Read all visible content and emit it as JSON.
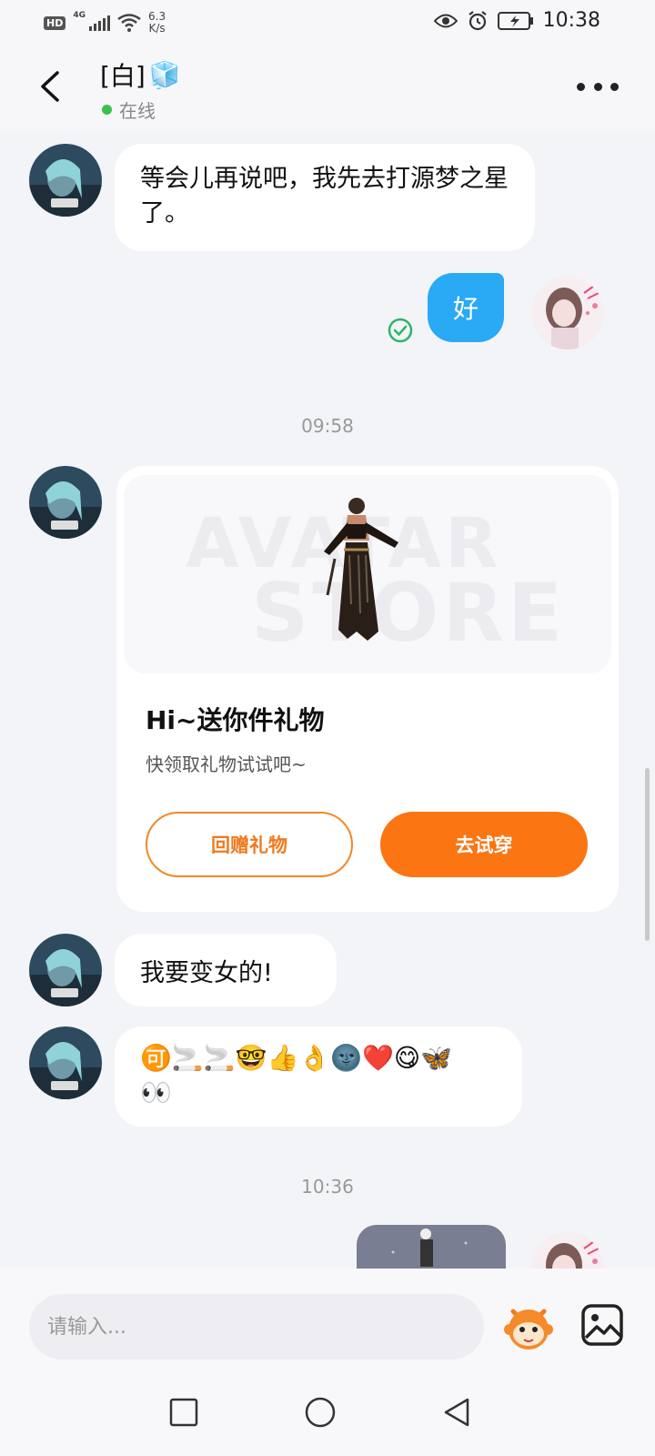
{
  "status_bar": {
    "hd": "HD",
    "network": "4G",
    "speed_value": "6.3",
    "speed_unit": "K/s",
    "time": "10:38"
  },
  "header": {
    "contact_name": "[白]",
    "contact_emoji": "🧊",
    "status": "在线",
    "status_color": "#3ac24c"
  },
  "messages": {
    "m1": {
      "from": "them",
      "text": "等会儿再说吧，我先去打源梦之星了。"
    },
    "m2": {
      "from": "me",
      "text": "好",
      "read_icon": "check-circle-icon"
    },
    "time1": "09:58",
    "gift": {
      "title": "Hi~送你件礼物",
      "subtitle": "快领取礼物试试吧~",
      "watermark_line1": "AVATAR",
      "watermark_line2": "STORE",
      "btn_return": "回赠礼物",
      "btn_try": "去试穿"
    },
    "m3": {
      "from": "them",
      "text": "我要变女的!"
    },
    "m4": {
      "from": "them",
      "text_line1": "🉑🚬🚬🤓👍👌🌚❤️😋🦋",
      "text_line2": "👀"
    },
    "time2": "10:36"
  },
  "input": {
    "placeholder": "请输入..."
  },
  "colors": {
    "accent_blue": "#2aa9f5",
    "accent_orange": "#fb7512",
    "read_green": "#2fb36a"
  }
}
